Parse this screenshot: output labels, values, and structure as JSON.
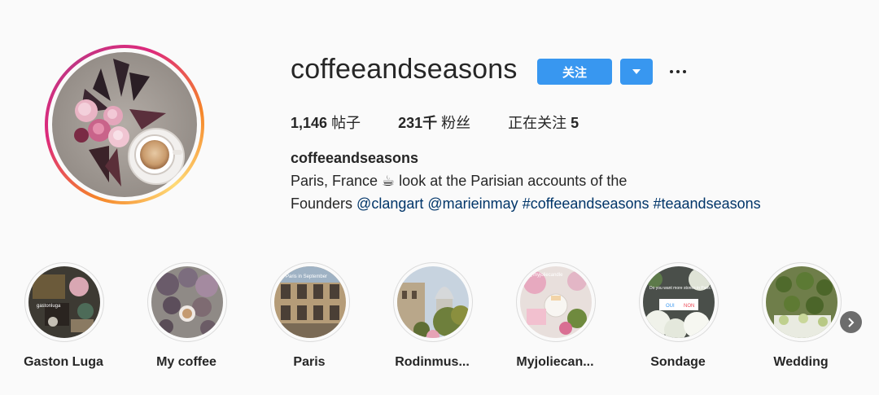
{
  "profile": {
    "username": "coffeeandseasons",
    "follow_label": "关注",
    "stats": [
      {
        "value": "1,146",
        "label": "帖子"
      },
      {
        "value": "231千",
        "label": "粉丝"
      },
      {
        "label": "正在关注",
        "value": "5"
      }
    ],
    "bio": {
      "name": "coffeeandseasons",
      "line1": "Paris, France ☕ look at the Parisian accounts of the",
      "line2_prefix": "Founders ",
      "links": [
        "@clangart",
        "@marieinmay",
        "#coffeeandseasons",
        "#teaandseasons"
      ]
    }
  },
  "highlights": [
    {
      "label": "Gaston Luga",
      "cover_text": "gastonluga"
    },
    {
      "label": "My coffee"
    },
    {
      "label": "Paris",
      "cover_text": "Paris in September"
    },
    {
      "label": "Rodinmus..."
    },
    {
      "label": "Myjoliecan...",
      "cover_text": "@myjoliecandle"
    },
    {
      "label": "Sondage",
      "cover_text": "Do you want more stories in Paris?",
      "poll_options": [
        "OUI",
        "NON"
      ]
    },
    {
      "label": "Wedding"
    }
  ],
  "colors": {
    "accent": "#3897f0",
    "link": "#003569",
    "text": "#262626",
    "background": "#fafafa"
  },
  "icons": {
    "dropdown": "caret-down-icon",
    "more": "more-horizontal-icon",
    "next": "chevron-right-icon"
  }
}
